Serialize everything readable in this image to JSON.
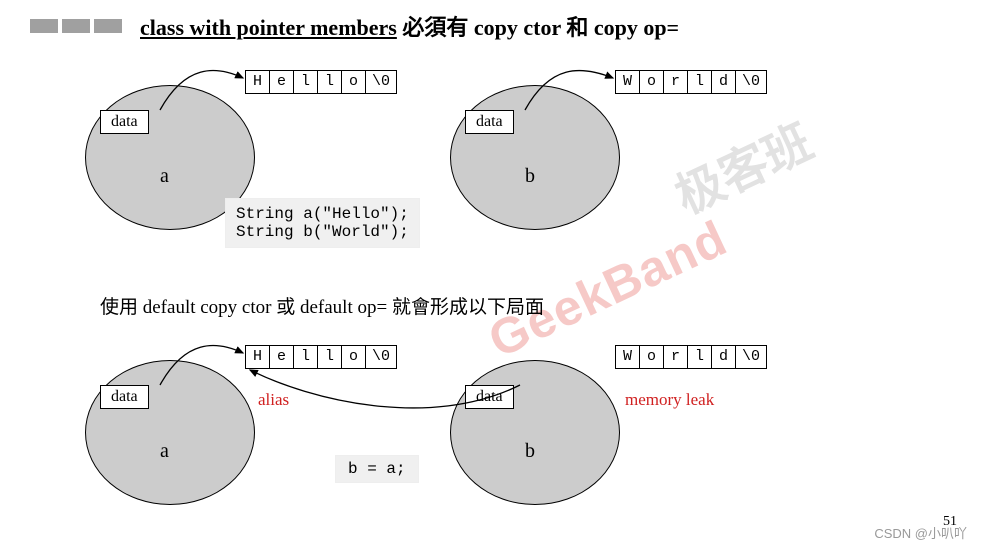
{
  "title": {
    "underlined": "class with pointer members",
    "rest": " 必須有 copy ctor 和 copy op="
  },
  "top_section": {
    "a": {
      "box_label": "data",
      "obj_label": "a",
      "chars": [
        "H",
        "e",
        "l",
        "l",
        "o",
        "\\0"
      ]
    },
    "b": {
      "box_label": "data",
      "obj_label": "b",
      "chars": [
        "W",
        "o",
        "r",
        "l",
        "d",
        "\\0"
      ]
    },
    "code": "String a(\"Hello\");\nString b(\"World\");"
  },
  "mid_text": "使用 default copy ctor 或 default op= 就會形成以下局面",
  "bottom_section": {
    "a": {
      "box_label": "data",
      "obj_label": "a",
      "chars": [
        "H",
        "e",
        "l",
        "l",
        "o",
        "\\0"
      ]
    },
    "b": {
      "box_label": "data",
      "obj_label": "b",
      "chars": [
        "W",
        "o",
        "r",
        "l",
        "d",
        "\\0"
      ]
    },
    "alias_label": "alias",
    "leak_label": "memory leak",
    "code": "b = a;"
  },
  "watermark_red": "GeekBand",
  "watermark_gray": "极客班",
  "footer": "CSDN @小叭吖",
  "page_number": "51"
}
